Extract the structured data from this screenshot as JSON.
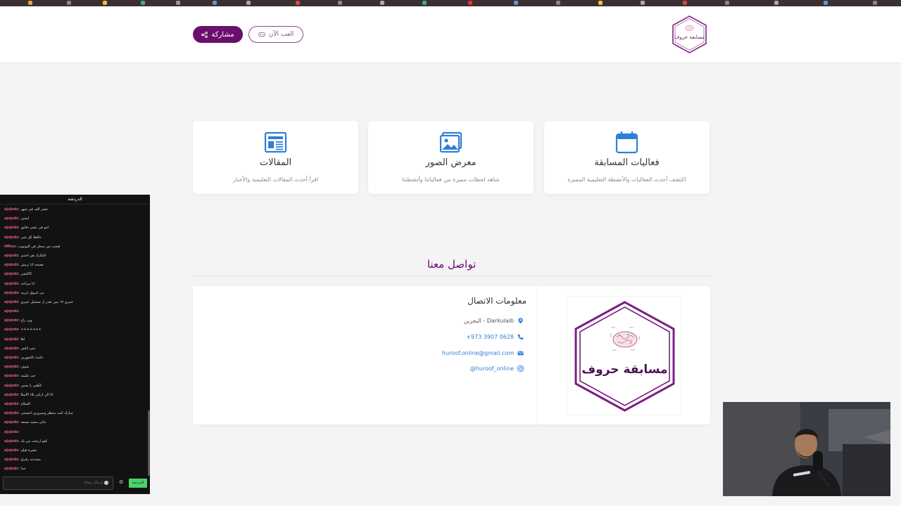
{
  "header": {
    "share_label": "مشاركة",
    "play_label": "العب الآن",
    "logo_text": "مسابقة حروف"
  },
  "cards": [
    {
      "title": "المقالات",
      "desc": "اقرأ أحدث المقالات التعليمية والأخبار",
      "icon": "newspaper-icon"
    },
    {
      "title": "معرض الصور",
      "desc": "شاهد لحظات مميزة من فعالياتنا وأنشطتنا",
      "icon": "image-icon"
    },
    {
      "title": "فعاليات المسابقة",
      "desc": "اكتشف أحدث الفعاليات والأنشطة التعليمية المميزة",
      "icon": "calendar-icon"
    }
  ],
  "contact": {
    "section_title": "تواصل معنا",
    "heading": "معلومات الاتصال",
    "location": "Darkulaib - البحرين",
    "phone": "+973 3907 0628",
    "email": "huroof.online@gmail.com",
    "instagram": "huroof_online@",
    "logo_text": "مسابقة حروف"
  },
  "chat": {
    "header": "الدردشة",
    "input_placeholder": "إرسال رسالة",
    "send_label": "الدردشة",
    "messages": [
      {
        "user": "ajojodz",
        "text": "عشر الف في شهر"
      },
      {
        "user": "ajojodz",
        "text": "ليجين"
      },
      {
        "user": "ajojodz",
        "text": "انتو في عشر دقايق"
      },
      {
        "user": "ajojodz",
        "text": "حافظ كل شي"
      },
      {
        "user": "iMhsz",
        "text": "قبحت من سحل في اليوتيوب"
      },
      {
        "user": "ajojodz",
        "text": "افكارك هي احدى"
      },
      {
        "user": "ajojodz",
        "text": "نصيحة انا بريش"
      },
      {
        "user": "ajojodz",
        "text": "الاكتشر"
      },
      {
        "user": "ajojodz",
        "text": "انا مرتاحه"
      },
      {
        "user": "ajojodz",
        "text": "من اسوق عربيه"
      },
      {
        "user": "ajojodz",
        "text": "عمري ١٧ بس نقدر ل تسجيل عمري"
      },
      {
        "user": "ajojodz",
        "text": ""
      },
      {
        "user": "ajojodz",
        "text": "وين راح"
      },
      {
        "user": "ajojodz",
        "text": "+++++++"
      },
      {
        "user": "ajojodz",
        "text": "اها"
      },
      {
        "user": "ajojodz",
        "text": "متى ابلش"
      },
      {
        "user": "ajojodz",
        "text": "حاسة بالشهرين"
      },
      {
        "user": "ajojodz",
        "text": "شوف"
      },
      {
        "user": "ajojodz",
        "text": "حب عليمه"
      },
      {
        "user": "ajojodz",
        "text": "لأهلين يا بحس"
      },
      {
        "user": "ajojodz",
        "text": "انا الي اركي بلاء الاسلا"
      },
      {
        "user": "ajojodz",
        "text": "السلام"
      },
      {
        "user": "ajojodz",
        "text": "مبارك كنت منتظر وسروري احسنتي"
      },
      {
        "user": "ajojodz",
        "text": "جائي سعيد مسعد"
      },
      {
        "user": "ajojodz",
        "text": ""
      },
      {
        "user": "ajojodz",
        "text": "كفو ارتحت من بك"
      },
      {
        "user": "ajojodz",
        "text": "عشرة فيلم"
      },
      {
        "user": "ajojodz",
        "text": "مسدعه رفرق"
      },
      {
        "user": "ajojodz",
        "text": "حدا"
      }
    ]
  },
  "colors": {
    "brand": "#6a0f6e",
    "icon_blue": "#2f7fd9"
  }
}
